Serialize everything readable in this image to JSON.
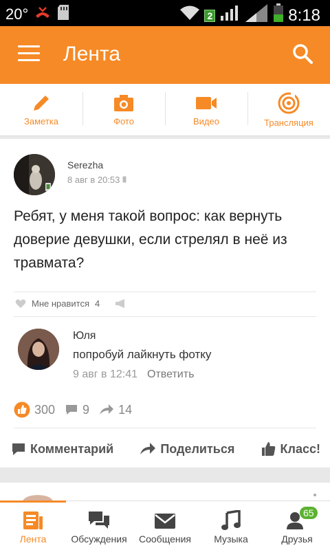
{
  "status_bar": {
    "left_text": "20°",
    "sim_label": "2",
    "time": "8:18"
  },
  "header": {
    "title": "Лента"
  },
  "actions": [
    {
      "label": "Заметка",
      "icon": "pencil-icon"
    },
    {
      "label": "Фото",
      "icon": "camera-icon"
    },
    {
      "label": "Видео",
      "icon": "video-camera-icon"
    },
    {
      "label": "Трансляция",
      "icon": "broadcast-icon"
    }
  ],
  "post": {
    "author": "Serezha",
    "time": "8 авг в 20:53",
    "text": "Ребят, у меня такой вопрос: как вернуть доверие девушки, если стрелял в неё из травмата?",
    "likes_label": "Мне нравится",
    "likes_count": "4"
  },
  "comment": {
    "author": "Юля",
    "text": "попробуй лайкнуть фотку",
    "time": "9 авг в 12:41",
    "reply_label": "Ответить"
  },
  "stats": {
    "classes": "300",
    "comments": "9",
    "shares": "14"
  },
  "post_actions": {
    "comment_label": "Комментарий",
    "share_label": "Поделиться",
    "class_label": "Класс!"
  },
  "nav": [
    {
      "label": "Лента",
      "icon": "feed-icon"
    },
    {
      "label": "Обсуждения",
      "icon": "discussions-icon"
    },
    {
      "label": "Сообщения",
      "icon": "messages-icon"
    },
    {
      "label": "Музыка",
      "icon": "music-icon"
    },
    {
      "label": "Друзья",
      "icon": "friends-icon",
      "badge": "65"
    }
  ],
  "colors": {
    "accent": "#f68a26",
    "badge_green": "#5bb230"
  }
}
